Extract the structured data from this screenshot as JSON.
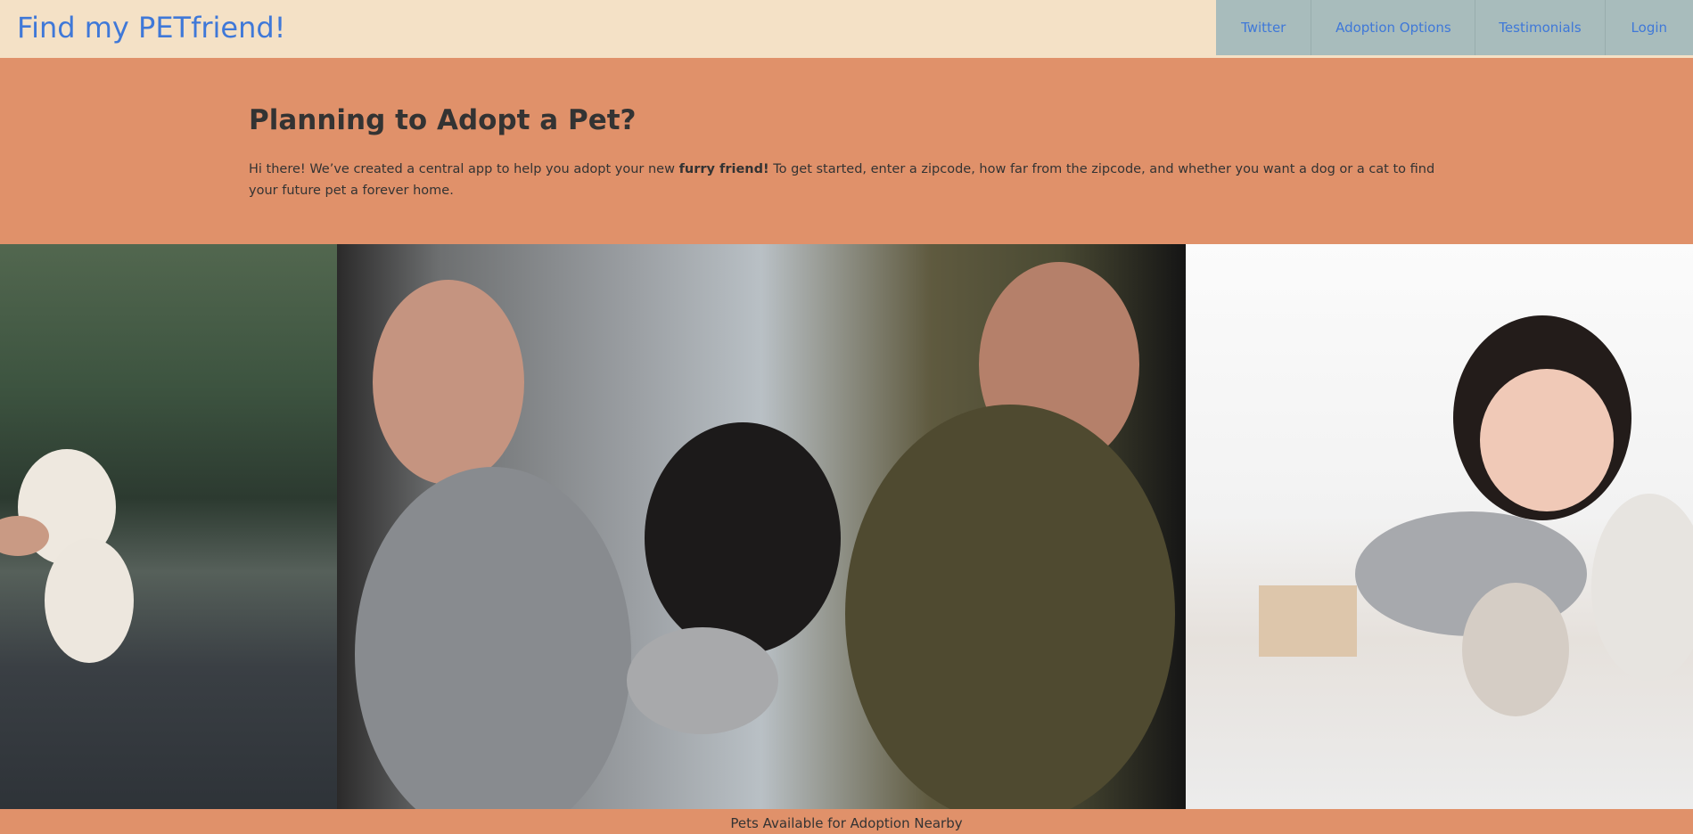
{
  "header": {
    "brand": "Find my PETfriend!",
    "nav": [
      "Twitter",
      "Adoption Options",
      "Testimonials",
      "Login"
    ]
  },
  "hero": {
    "title": "Planning to Adopt a Pet?",
    "text_before": "Hi there! We’ve created a central app to help you adopt your new ",
    "text_bold": "furry friend!",
    "text_after": " To get started, enter a zipcode, how far from the zipcode, and whether you want a dog or a cat to find your future pet a forever home."
  },
  "photos": [
    {
      "name": "dog-on-walk-photo"
    },
    {
      "name": "couple-with-dog-photo"
    },
    {
      "name": "girl-with-cats-photo"
    }
  ],
  "footer": {
    "label": "Pets Available for Adoption Nearby"
  },
  "colors": {
    "header_bg": "#f4e1c6",
    "nav_bg": "#a8bcbc",
    "accent": "#e0916a",
    "link": "#3f78d8",
    "text": "#333333"
  }
}
